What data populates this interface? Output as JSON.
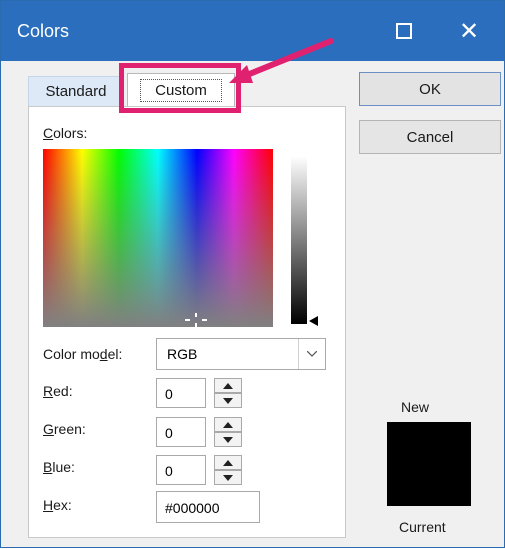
{
  "window": {
    "title": "Colors",
    "close_glyph": "✕"
  },
  "tabs": [
    {
      "label": "Standard",
      "selected": false
    },
    {
      "label": "Custom",
      "selected": true
    }
  ],
  "custom": {
    "colors_label_first": "C",
    "colors_label_rest": "olors:",
    "color_model_label_pre": "Color mo",
    "color_model_label_ul": "d",
    "color_model_label_post": "el:",
    "color_model_value": "RGB",
    "red_label_ul": "R",
    "red_label_rest": "ed:",
    "red_value": "0",
    "green_label_ul": "G",
    "green_label_rest": "reen:",
    "green_value": "0",
    "blue_label_ul": "B",
    "blue_label_rest": "lue:",
    "blue_value": "0",
    "hex_label_ul": "H",
    "hex_label_rest": "ex:",
    "hex_value": "#000000"
  },
  "buttons": {
    "ok": "OK",
    "cancel": "Cancel"
  },
  "preview": {
    "new_label": "New",
    "current_label": "Current",
    "color": "#000000"
  },
  "colors": {
    "titlebar": "#2a6ebd",
    "annotation": "#e0216f"
  },
  "icons": {
    "maximize": "maximize-icon",
    "close": "close-icon",
    "dropdown": "chevron-down-icon",
    "spin_up": "triangle-up-icon",
    "spin_down": "triangle-down-icon"
  }
}
